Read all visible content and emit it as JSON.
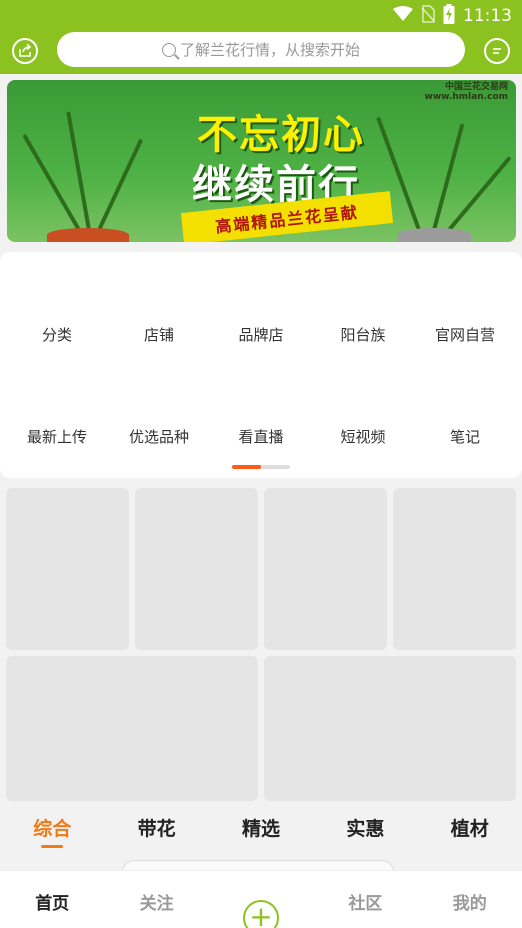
{
  "status_bar": {
    "time": "11:13"
  },
  "search": {
    "placeholder": "了解兰花行情，从搜索开始"
  },
  "banner": {
    "title_line1": "不忘初心",
    "title_line2": "继续前行",
    "ribbon": "高端精品兰花呈献",
    "site_name": "中国兰花交易网",
    "site_url": "www.hmlan.com"
  },
  "menu": {
    "row1": [
      "分类",
      "店铺",
      "品牌店",
      "阳台族",
      "官网自营"
    ],
    "row2": [
      "最新上传",
      "优选品种",
      "看直播",
      "短视频",
      "笔记"
    ],
    "page_index": 1,
    "page_count": 2
  },
  "tabs": [
    "综合",
    "带花",
    "精选",
    "实惠",
    "植材"
  ],
  "active_tab": "综合",
  "bottom_nav": {
    "home": "首页",
    "follow": "关注",
    "add": "+",
    "community": "社区",
    "mine": "我的"
  },
  "colors": {
    "brand": "#8cc21f",
    "accent": "#f07a16",
    "pager_active": "#ff5a1a"
  }
}
